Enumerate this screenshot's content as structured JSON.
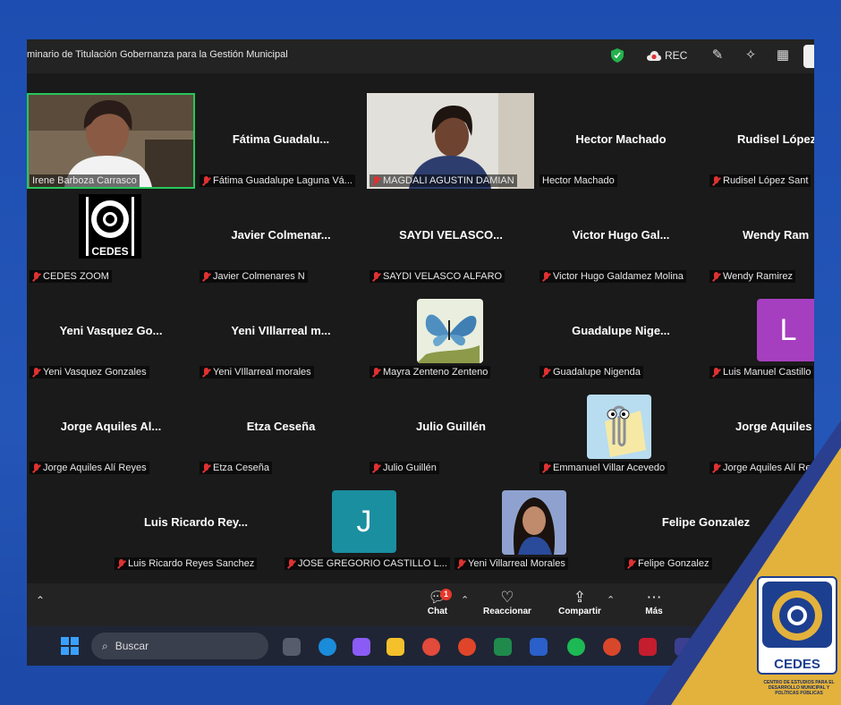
{
  "window": {
    "title": "minario de Titulación Gobernanza para la  Gestión Municipal",
    "rec_label": "REC"
  },
  "tiles": [
    {
      "name": "",
      "label": "Irene Barboza Carrasco",
      "muted": false
    },
    {
      "name": "Fátima  Guadalu...",
      "label": "Fátima Guadalupe Laguna Vá...",
      "muted": true
    },
    {
      "name": "",
      "label": "MAGDALI AGUSTIN DAMIAN",
      "muted": true
    },
    {
      "name": "Hector Machado",
      "label": "Hector Machado",
      "muted": false
    },
    {
      "name": "Rudisel  López",
      "label": "Rudisel López Sant",
      "muted": true
    },
    {
      "name": "",
      "label": "CEDES ZOOM",
      "muted": true
    },
    {
      "name": "Javier  Colmenar...",
      "label": "Javier Colmenares N",
      "muted": true
    },
    {
      "name": "SAYDI  VELASCO...",
      "label": "SAYDI VELASCO ALFARO",
      "muted": true
    },
    {
      "name": "Victor  Hugo  Gal...",
      "label": "Victor Hugo Galdamez Molina",
      "muted": true
    },
    {
      "name": "Wendy  Ram",
      "label": "Wendy Ramirez",
      "muted": true
    },
    {
      "name": "Yeni  Vasquez  Go...",
      "label": "Yeni Vasquez Gonzales",
      "muted": true
    },
    {
      "name": "Yeni  VIllarreal  m...",
      "label": "Yeni VIllarreal morales",
      "muted": true
    },
    {
      "name": "",
      "label": "Mayra Zenteno Zenteno",
      "muted": true
    },
    {
      "name": "Guadalupe  Nige...",
      "label": "Guadalupe Nigenda",
      "muted": true
    },
    {
      "name": "",
      "label": "Luis Manuel Castillo",
      "muted": true
    },
    {
      "name": "Jorge  Aquiles  Al...",
      "label": "Jorge Aquiles Alí Reyes",
      "muted": true
    },
    {
      "name": "Etza  Ceseña",
      "label": "Etza Ceseña",
      "muted": true
    },
    {
      "name": "Julio  Guillén",
      "label": "Julio Guillén",
      "muted": true
    },
    {
      "name": "",
      "label": "Emmanuel Villar Acevedo",
      "muted": true
    },
    {
      "name": "Jorge  Aquiles",
      "label": "Jorge Aquiles Alí Re",
      "muted": true
    },
    {
      "name": "Luis  Ricardo  Rey...",
      "label": "Luis Ricardo Reyes Sanchez",
      "muted": true
    },
    {
      "name": "",
      "label": "JOSE GREGORIO CASTILLO L...",
      "muted": true
    },
    {
      "name": "",
      "label": "Yeni Villarreal Morales",
      "muted": true
    },
    {
      "name": "Felipe  Gonzalez",
      "label": "Felipe Gonzalez",
      "muted": true
    }
  ],
  "avatars": {
    "luis_manuel": "L",
    "jose_gregorio": "J",
    "cedes_tile": "CEDES"
  },
  "toolbar": {
    "chat": "Chat",
    "chat_badge": "1",
    "react": "Reaccionar",
    "share": "Compartir",
    "more": "Más"
  },
  "taskbar": {
    "search": "Buscar"
  },
  "logo": {
    "text": "CEDES",
    "sub": "CENTRO DE ESTUDIOS PARA EL DESARROLLO MUNICIPAL Y POLÍTICAS PÚBLICAS"
  },
  "colors": {
    "active_border": "#26c85a",
    "mute_red": "#e03131",
    "avatar_purple": "#a63fbf",
    "avatar_teal": "#1a8fa0"
  }
}
